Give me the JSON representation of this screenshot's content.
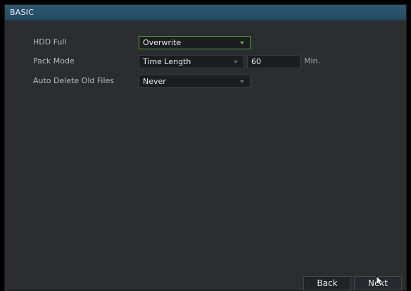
{
  "window": {
    "title": "BASIC"
  },
  "settings": {
    "hdd_full": {
      "label": "HDD Full",
      "value": "Overwrite"
    },
    "pack_mode": {
      "label": "Pack Mode",
      "value": "Time Length",
      "length": "60",
      "unit": "Min."
    },
    "auto_delete": {
      "label": "Auto Delete Old Files",
      "value": "Never"
    }
  },
  "buttons": {
    "back": "Back",
    "next": "Next"
  },
  "colors": {
    "titlebar": "#2f5871",
    "active_border": "#4fa634",
    "panel": "#2b2d31"
  },
  "icons": {
    "dropdown": "chevron-down-icon",
    "cursor": "mouse-pointer-icon"
  }
}
